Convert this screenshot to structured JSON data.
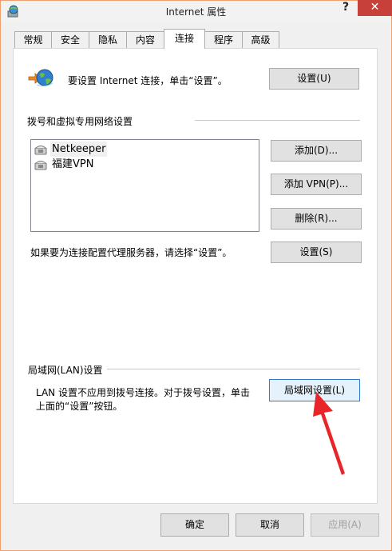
{
  "window": {
    "title": "Internet 属性",
    "help_label": "?",
    "close_label": "✕"
  },
  "tabs": [
    "常规",
    "安全",
    "隐私",
    "内容",
    "连接",
    "程序",
    "高级"
  ],
  "active_tab": "连接",
  "setup": {
    "text": "要设置 Internet 连接，单击“设置”。",
    "button": "设置(U)"
  },
  "dialup": {
    "heading": "拨号和虚拟专用网络设置",
    "connections": [
      "Netkeeper",
      "福建VPN"
    ],
    "add_button": "添加(D)...",
    "add_vpn_button": "添加 VPN(P)...",
    "remove_button": "删除(R)...",
    "proxy_text": "如果要为连接配置代理服务器，请选择“设置”。",
    "settings_button": "设置(S)"
  },
  "lan": {
    "heading": "局域网(LAN)设置",
    "text_line1": "LAN 设置不应用到拨号连接。对于拨号设置，单击",
    "text_line2": "上面的“设置”按钮。",
    "button": "局域网设置(L)"
  },
  "footer": {
    "ok": "确定",
    "cancel": "取消",
    "apply": "应用(A)"
  },
  "annotation": {
    "arrow_color": "#e8262a"
  }
}
